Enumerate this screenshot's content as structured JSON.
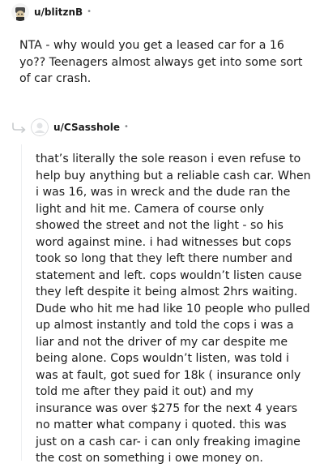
{
  "parent_comment": {
    "author": "u/blitznB",
    "separator": "•",
    "avatar_icon": "snoo-avatar-icon",
    "body": "NTA - why would you get a leased car for a 16 yo?? Teenagers almost always get into some sort of car crash."
  },
  "reply_comment": {
    "author": "u/CSasshole",
    "separator": "•",
    "avatar_icon": "default-avatar-icon",
    "reply_icon": "reply-arrow-icon",
    "body": "that’s literally the sole reason i even refuse to help buy anything but a reliable cash car. When i was 16, was in wreck and the dude ran the light and hit me. Camera of course only showed the street and not the light - so his word against mine. i had witnesses but cops took so long that they left there number and statement and left. cops wouldn’t listen cause they left despite it being almost 2hrs waiting. Dude who hit me had like 10 people who pulled up almost instantly and told the cops i was a liar and not the driver of my car despite me being alone. Cops wouldn’t listen, was told i was at fault, got sued for 18k ( insurance only told me after they paid it out) and my insurance was over $275 for the next 4 years no matter what company i quoted. this was just on a cash car- i can only freaking imagine the cost on something i owe money on."
  }
}
